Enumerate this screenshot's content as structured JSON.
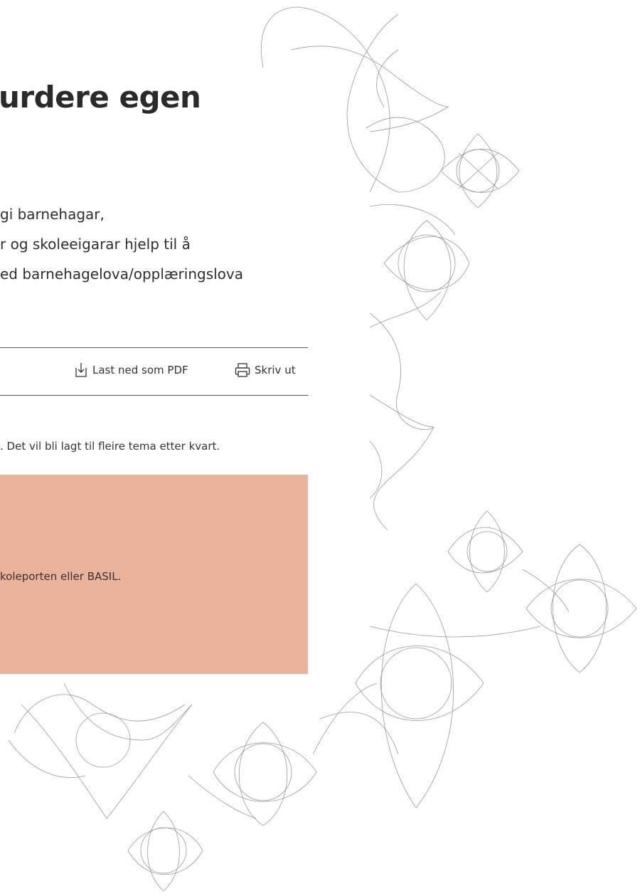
{
  "header": {
    "title": "urdere egen"
  },
  "intro": {
    "lines": [
      " gi barnehagar,",
      "r og skoleeigarar hjelp til å",
      "ed barnehagelova/opplæringslova"
    ]
  },
  "toolbar": {
    "download_label": "Last ned som PDF",
    "download_icon": "download-icon",
    "print_label": "Skriv ut",
    "print_icon": "printer-icon"
  },
  "note": ". Det vil bli lagt til fleire tema etter kvart.",
  "callout": {
    "text": "koleporten eller BASIL.",
    "background": "#ebb39b"
  }
}
